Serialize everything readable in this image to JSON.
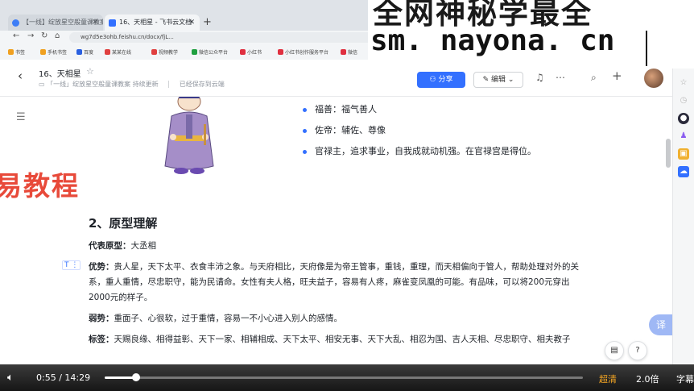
{
  "browser": {
    "tabs": [
      {
        "label": "【一线】绽放星空般童课教案 - 飞书"
      },
      {
        "label": "16、天相星 - 飞书云文档"
      }
    ],
    "new_tab": "+",
    "url": "wg7d5e3ohb.feishu.cn/docx/fjL...",
    "bookmarks": [
      "书签",
      "手机书签",
      "百度",
      "某某在线",
      "视频教学",
      "微信公众平台",
      "小红书",
      "小红书创作服务平台",
      "微信"
    ]
  },
  "watermark": {
    "line1": "全网神秘学最全",
    "line2": "sm. nayona. cn"
  },
  "doc": {
    "title": "16、天相星",
    "breadcrumb_space": "「一线」绽放星空般童课教案 持续更新",
    "breadcrumb_status": "已经保存到云端",
    "share_label": "分享",
    "edit_label": "编辑"
  },
  "content": {
    "overlay_text": "易教程",
    "bullets": [
      "福善：福气善人",
      "佐帝：辅佐、尊像",
      "官禄主，追求事业，自我成就动机强。在官禄宫是得位。"
    ],
    "heading": "2、原型理解",
    "rep_label": "代表原型：",
    "rep_value": "大丞相",
    "adv_label": "优势：",
    "adv_text": "贵人星，天下太平、衣食丰沛之象。与天府相比，天府像是为帝王管事，重钱，重理，而天相偏向于管人，帮助处理对外的关系，重人重情，尽忠职守，能为民请命。女性有夫人格，旺夫益子，容易有人疼，麻雀变凤凰的可能。有品味，可以将200元穿出2000元的样子。",
    "weak_label": "弱势：",
    "weak_text": "重面子、心很软，过于重情，容易一不小心进入别人的感情。",
    "tag_label": "标签：",
    "tag_text": "天赐良缘、相得益彰、天下一家、相辅相成、天下太平、相安无事、天下大乱、相忍为国、吉人天相、尽忠职守、相夫教子",
    "translate": "译"
  },
  "player": {
    "current": "0:55",
    "separator": "/",
    "total": "14:29",
    "progress": 0.065,
    "quality": "超清",
    "speed": "2.0倍",
    "subtitles": "字幕"
  },
  "colors": {
    "accent": "#3370ff",
    "overlay_red": "#e84a3a",
    "quality": "#f5a623"
  }
}
